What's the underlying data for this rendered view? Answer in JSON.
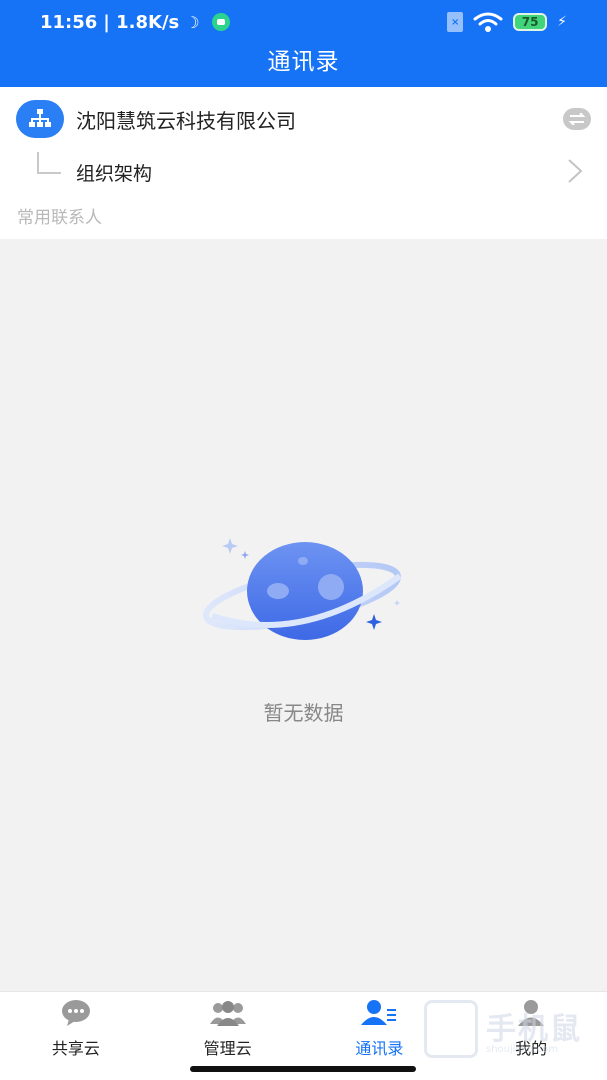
{
  "status_bar": {
    "time": "11:56",
    "net_speed": "| 1.8K/s",
    "battery": "75"
  },
  "header": {
    "title": "通讯录"
  },
  "company": {
    "name": "沈阳慧筑云科技有限公司"
  },
  "org": {
    "label": "组织架构"
  },
  "section": {
    "frequent_contacts": "常用联系人"
  },
  "empty_state": {
    "text": "暂无数据"
  },
  "tabs": [
    {
      "label": "共享云",
      "icon": "chat-bubble-icon"
    },
    {
      "label": "管理云",
      "icon": "group-icon"
    },
    {
      "label": "通讯录",
      "icon": "contacts-icon",
      "active": true
    },
    {
      "label": "我的",
      "icon": "person-icon"
    }
  ],
  "watermark": {
    "text": "手机鼠",
    "sub": "shoujishu.com"
  },
  "colors": {
    "brand": "#1773f6",
    "background": "#f2f2f2",
    "muted_text": "#b8b8b8"
  }
}
